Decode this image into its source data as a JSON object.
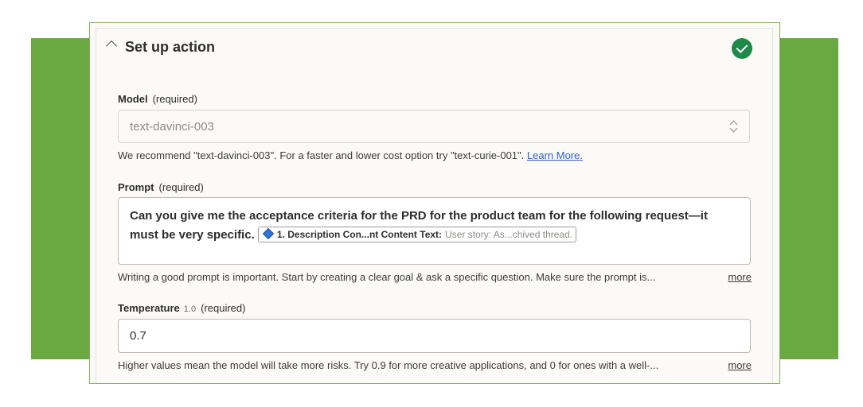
{
  "section": {
    "title": "Set up action",
    "status_icon": "check-circle-icon",
    "status_color": "#1f8a47"
  },
  "model": {
    "label": "Model",
    "required": "(required)",
    "value": "text-davinci-003",
    "help_text": "We recommend \"text-davinci-003\". For a faster and lower cost option try \"text-curie-001\".",
    "help_link": "Learn More."
  },
  "prompt": {
    "label": "Prompt",
    "required": "(required)",
    "text": "Can you give me the acceptance criteria for the PRD for the product team for the following request—it must be very specific.",
    "pill_name": "1. Description Con...nt Content Text:",
    "pill_value": "User story: As...chived thread.",
    "help_text": "Writing a good prompt is important. Start by creating a clear goal & ask a specific question. Make sure the prompt is...",
    "more_label": "more"
  },
  "temperature": {
    "label": "Temperature",
    "version": "1.0",
    "required": "(required)",
    "value": "0.7",
    "help_text": "Higher values mean the model will take more risks. Try 0.9 for more creative applications, and 0 for ones with a well-...",
    "more_label": "more"
  },
  "colors": {
    "background_band": "#6aa841",
    "panel_bg": "#fbfaf6",
    "link": "#2c5fd6"
  }
}
